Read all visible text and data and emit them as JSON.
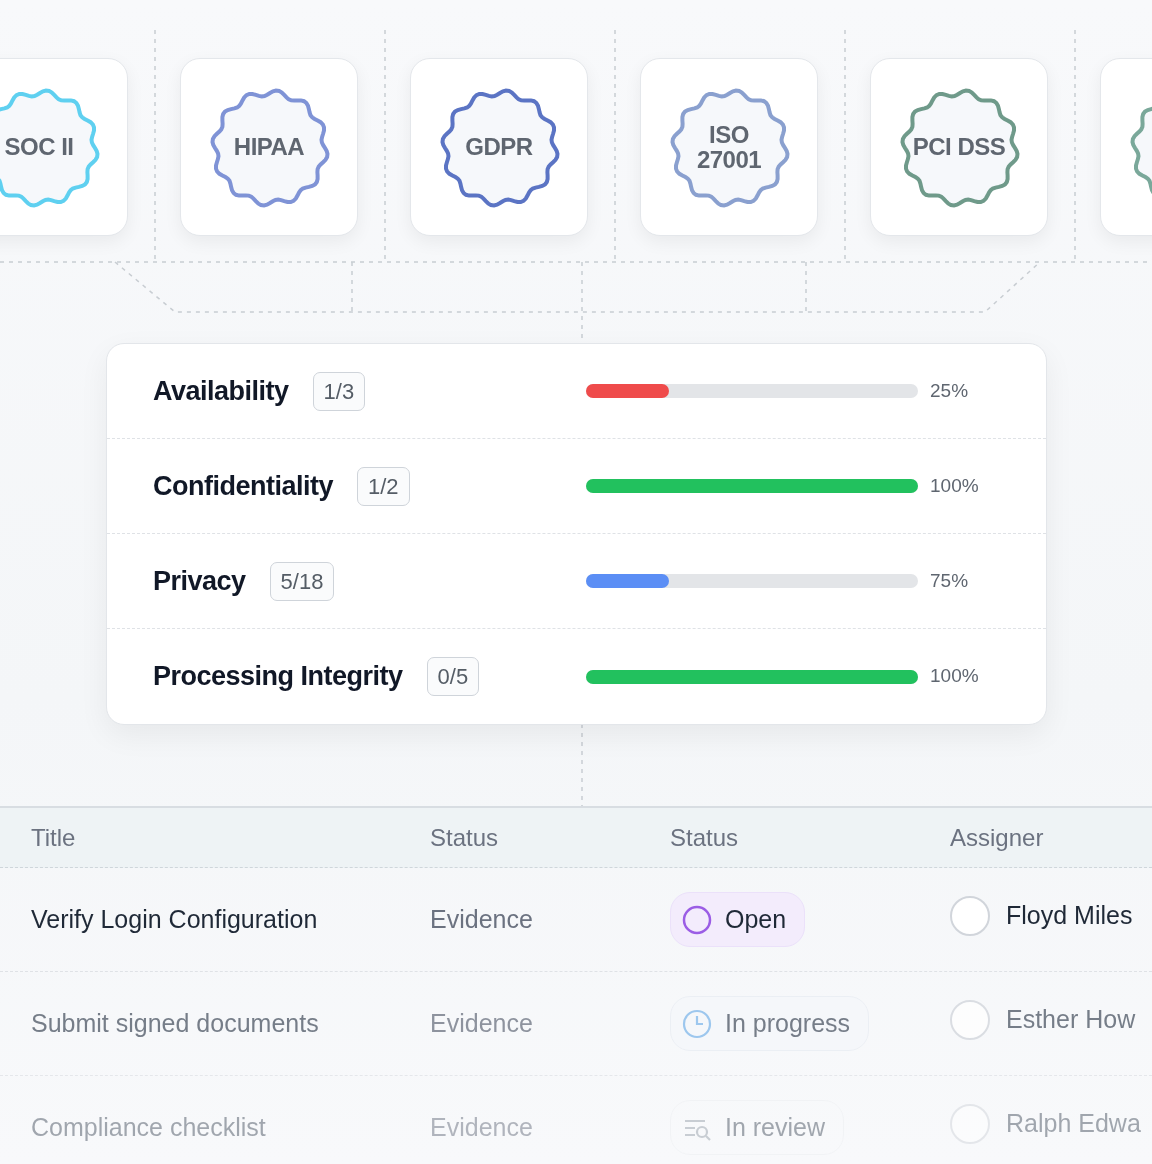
{
  "certifications": [
    {
      "label": "SOC II",
      "color": "#5fd0f0"
    },
    {
      "label": "HIPAA",
      "color": "#7f93d6"
    },
    {
      "label": "GDPR",
      "color": "#5b74c4"
    },
    {
      "label": "ISO 27001",
      "color": "#8aa0cf"
    },
    {
      "label": "PCI DSS",
      "color": "#6f9a8a"
    },
    {
      "color": "#7aa89a"
    }
  ],
  "criteria": [
    {
      "name": "Availability",
      "count": "1/3",
      "level": 0.25,
      "color": "#ef4b4b",
      "percent": "25%"
    },
    {
      "name": "Confidentiality",
      "count": "1/2",
      "level": 1,
      "color": "#22c15e",
      "percent": "100%"
    },
    {
      "name": "Privacy",
      "count": "5/18",
      "level": 0.25,
      "color": "#5b8ef5",
      "percent": "75%"
    },
    {
      "name": "Processing Integrity",
      "count": "0/5",
      "level": 1,
      "color": "#22c15e",
      "percent": "100%"
    }
  ],
  "table": {
    "columns": [
      "Title",
      "Status",
      "Status",
      "Assigner"
    ],
    "rows": [
      {
        "title": "Verify Login Configuration",
        "type": "Evidence",
        "status": {
          "kind": "open",
          "label": "Open"
        },
        "assigner": "Floyd Miles"
      },
      {
        "title": "Submit signed documents",
        "type": "Evidence",
        "status": {
          "kind": "in_progress",
          "label": "In progress"
        },
        "assigner": "Esther How"
      },
      {
        "title": "Compliance checklist",
        "type": "Evidence",
        "status": {
          "kind": "in_review",
          "label": "In review"
        },
        "assigner": "Ralph Edwa"
      }
    ]
  }
}
